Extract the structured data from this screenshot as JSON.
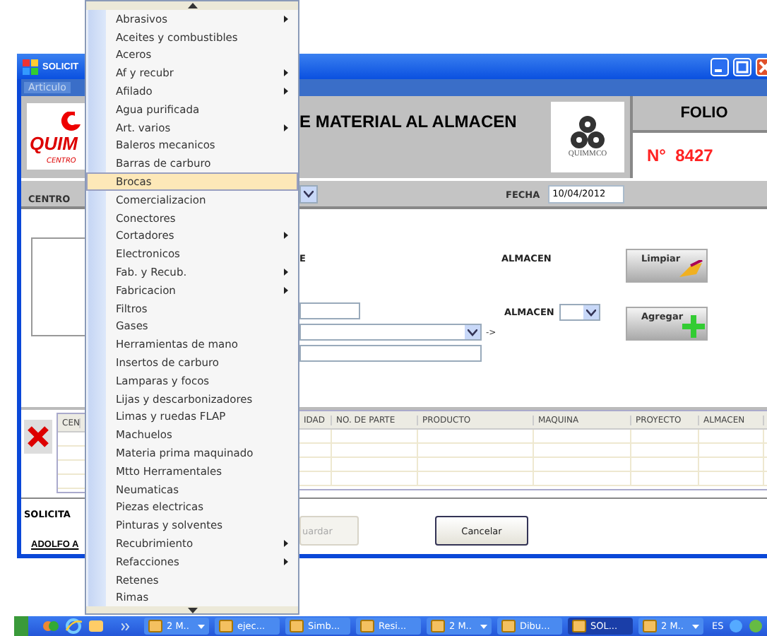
{
  "window": {
    "title": "SOLICIT",
    "menu": [
      "Articulo"
    ]
  },
  "header": {
    "logo_text": "QUIM",
    "logo_subtext": "CENTRO",
    "title": "E MATERIAL AL ALMACEN",
    "brand": "QUIMMCO",
    "folio_label": "FOLIO",
    "folio_number": "N°  8427"
  },
  "bar": {
    "center_label": "CENTRO",
    "date_label": "FECHA",
    "date_value": "10/04/2012"
  },
  "form": {
    "label": "E",
    "warehouse_label": "ALMACEN",
    "clear_button": "Limpiar",
    "warehouse_label_2": "ALMACEN",
    "add_button": "Agregar",
    "arrow": "->"
  },
  "grid": {
    "left_columns": [
      "CEN"
    ],
    "columns": [
      "IDAD",
      "NO. DE PARTE",
      "PRODUCTO",
      "MAQUINA",
      "PROYECTO",
      "ALMACEN"
    ]
  },
  "footer": {
    "requester_label": "SOLICITA",
    "requester_name": "ADOLFO A",
    "buttons": [
      {
        "label": "uardar",
        "disabled": true
      },
      {
        "label": "Cancelar",
        "disabled": false
      }
    ]
  },
  "menu": {
    "items": [
      {
        "label": "Abrasivos",
        "submenu": true,
        "selected": false
      },
      {
        "label": "Aceites y combustibles",
        "submenu": false,
        "selected": false
      },
      {
        "label": "Aceros",
        "submenu": false,
        "selected": false
      },
      {
        "label": "Af y recubr",
        "submenu": true,
        "selected": false
      },
      {
        "label": "Afilado",
        "submenu": true,
        "selected": false
      },
      {
        "label": "Agua purificada",
        "submenu": false,
        "selected": false
      },
      {
        "label": "Art. varios",
        "submenu": true,
        "selected": false
      },
      {
        "label": "Baleros mecanicos",
        "submenu": false,
        "selected": false
      },
      {
        "label": "Barras de carburo",
        "submenu": false,
        "selected": false
      },
      {
        "label": "Brocas",
        "submenu": false,
        "selected": true
      },
      {
        "label": "Comercializacion",
        "submenu": false,
        "selected": false
      },
      {
        "label": "Conectores",
        "submenu": false,
        "selected": false
      },
      {
        "label": "Cortadores",
        "submenu": true,
        "selected": false
      },
      {
        "label": "Electronicos",
        "submenu": false,
        "selected": false
      },
      {
        "label": "Fab. y Recub.",
        "submenu": true,
        "selected": false
      },
      {
        "label": "Fabricacion",
        "submenu": true,
        "selected": false
      },
      {
        "label": "Filtros",
        "submenu": false,
        "selected": false
      },
      {
        "label": "Gases",
        "submenu": false,
        "selected": false
      },
      {
        "label": "Herramientas de mano",
        "submenu": false,
        "selected": false
      },
      {
        "label": "Insertos de carburo",
        "submenu": false,
        "selected": false
      },
      {
        "label": "Lamparas y focos",
        "submenu": false,
        "selected": false
      },
      {
        "label": "Lijas y descarbonizadores",
        "submenu": false,
        "selected": false
      },
      {
        "label": "Limas y ruedas FLAP",
        "submenu": false,
        "selected": false
      },
      {
        "label": "Machuelos",
        "submenu": false,
        "selected": false
      },
      {
        "label": "Materia prima maquinado",
        "submenu": false,
        "selected": false
      },
      {
        "label": "Mtto Herramentales",
        "submenu": false,
        "selected": false
      },
      {
        "label": "Neumaticas",
        "submenu": false,
        "selected": false
      },
      {
        "label": "Piezas electricas",
        "submenu": false,
        "selected": false
      },
      {
        "label": "Pinturas y solventes",
        "submenu": false,
        "selected": false
      },
      {
        "label": "Recubrimiento",
        "submenu": true,
        "selected": false
      },
      {
        "label": "Refacciones",
        "submenu": true,
        "selected": false
      },
      {
        "label": "Retenes",
        "submenu": false,
        "selected": false
      },
      {
        "label": "Rimas",
        "submenu": false,
        "selected": false
      }
    ]
  },
  "taskbar": {
    "buttons": [
      {
        "label": "2 M..",
        "dropdown": true,
        "active": false
      },
      {
        "label": "ejec...",
        "dropdown": false,
        "active": false
      },
      {
        "label": "Simb...",
        "dropdown": false,
        "active": false
      },
      {
        "label": "Resi...",
        "dropdown": false,
        "active": false
      },
      {
        "label": "2 M..",
        "dropdown": true,
        "active": false
      },
      {
        "label": "Dibu...",
        "dropdown": false,
        "active": false
      },
      {
        "label": "SOL...",
        "dropdown": false,
        "active": true
      },
      {
        "label": "2 M..",
        "dropdown": true,
        "active": false
      }
    ],
    "language": "ES"
  }
}
